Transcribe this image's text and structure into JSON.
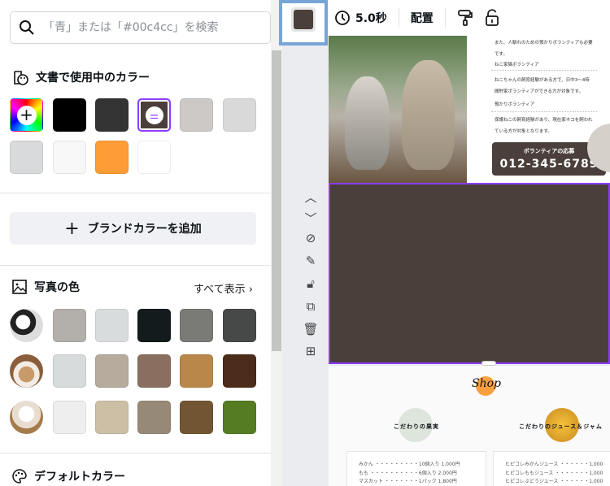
{
  "search": {
    "placeholder": "「青」または「#00c4cc」を検索"
  },
  "doc_colors": {
    "title": "文書で使用中のカラー",
    "swatches": [
      "#000000",
      "#333333",
      "#4a3f3a",
      "#cdc9c6",
      "#d9d9d9",
      "#d8dadc",
      "#f8f8f8",
      "#fe9c35",
      "#ffffff"
    ]
  },
  "brand": {
    "add_label": "ブランドカラーを追加"
  },
  "photo_colors": {
    "title": "写真の色",
    "see_all": "すべて表示",
    "rows": [
      [
        "#b3b0ab",
        "#d9dcdd",
        "#141b1d",
        "#7a7b77",
        "#464948"
      ],
      [
        "#d7dbdb",
        "#b7ab9e",
        "#8a6e5f",
        "#b98749",
        "#4b2b1a"
      ],
      [
        "#eeeeee",
        "#cdbfa5",
        "#978977",
        "#725634",
        "#557c23"
      ]
    ]
  },
  "default_colors": {
    "title": "デフォルトカラー"
  },
  "toolbar": {
    "duration": "5.0秒",
    "arrange": "配置",
    "selected_color": "#4a3f3a"
  },
  "canvas": {
    "page1": {
      "lines": [
        "また、人馴れのための預かりボランティアも必要",
        "です。",
        "ねこ家猫ボランティア",
        "ねこちゃんの飼育経験がある方で、日中3〜4時",
        "間貯家ボランティアができる方が対象です。",
        "預かりボランティア",
        "保護ねこの飼育経験があり、現在家ネコを飼われ",
        "ている方が対象となります。"
      ],
      "cta_title": "ボランティアの応募",
      "phone": "012-345-6789"
    },
    "page3": {
      "logo": "Shop",
      "left_title": "こだわりの果実",
      "right_title": "こだわりのジュース＆ジャム",
      "left_items": [
        "みかん ・・・・・・・・・10個入り 1,000円",
        "もも ・・・・・・・・・・6個入り 2,000円",
        "マスカット ・・・・・・・1パック 1,800円"
      ],
      "right_items": [
        "ヒピコレみかんジュース ・・・・・・1,000",
        "ヒピコレももジュース ・・・・・・・1,000",
        "ヒピコレぶどうジュース ・・・・・・1,000"
      ]
    }
  },
  "accent": "#8b3dff"
}
